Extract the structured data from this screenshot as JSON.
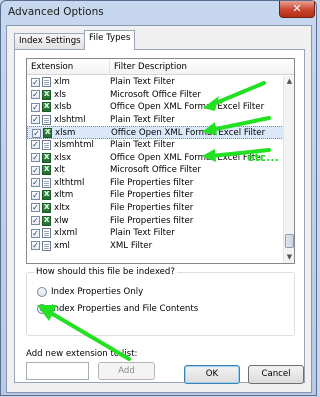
{
  "window": {
    "title": "Advanced Options",
    "close_glyph": "✕"
  },
  "tabs": [
    {
      "label": "Index Settings",
      "active": false
    },
    {
      "label": "File Types",
      "active": true
    }
  ],
  "list": {
    "headers": {
      "extension": "Extension",
      "description": "Filter Description"
    },
    "rows": [
      {
        "ext": "xlm",
        "desc": "Plain Text Filter",
        "checked": true,
        "icon": "generic-file-icon"
      },
      {
        "ext": "xls",
        "desc": "Microsoft Office Filter",
        "checked": true,
        "icon": "excel-file-icon"
      },
      {
        "ext": "xlsb",
        "desc": "Office Open XML Format Excel Filter",
        "checked": true,
        "icon": "excel-file-icon"
      },
      {
        "ext": "xlshtml",
        "desc": "Plain Text Filter",
        "checked": true,
        "icon": "generic-file-icon"
      },
      {
        "ext": "xlsm",
        "desc": "Office Open XML Format Excel Filter",
        "checked": true,
        "icon": "excel-file-icon",
        "selected": true
      },
      {
        "ext": "xlsmhtml",
        "desc": "Plain Text Filter",
        "checked": true,
        "icon": "generic-file-icon"
      },
      {
        "ext": "xlsx",
        "desc": "Office Open XML Format Excel Filter",
        "checked": true,
        "icon": "excel-file-icon"
      },
      {
        "ext": "xlt",
        "desc": "Microsoft Office Filter",
        "checked": true,
        "icon": "excel-file-icon"
      },
      {
        "ext": "xlthtml",
        "desc": "File Properties filter",
        "checked": true,
        "icon": "generic-file-icon"
      },
      {
        "ext": "xltm",
        "desc": "File Properties filter",
        "checked": true,
        "icon": "excel-file-icon"
      },
      {
        "ext": "xltx",
        "desc": "File Properties filter",
        "checked": true,
        "icon": "excel-file-icon"
      },
      {
        "ext": "xlw",
        "desc": "File Properties filter",
        "checked": true,
        "icon": "excel-file-icon"
      },
      {
        "ext": "xlxml",
        "desc": "Plain Text Filter",
        "checked": true,
        "icon": "generic-file-icon"
      },
      {
        "ext": "xml",
        "desc": "XML Filter",
        "checked": true,
        "icon": "generic-file-icon"
      }
    ]
  },
  "indexing": {
    "question": "How should this file be indexed?",
    "options": [
      {
        "label": "Index Properties Only",
        "selected": false
      },
      {
        "label": "Index Properties and File Contents",
        "selected": true
      }
    ]
  },
  "add_extension": {
    "label": "Add new extension to list:",
    "value": "",
    "button": "Add"
  },
  "buttons": {
    "ok": "OK",
    "cancel": "Cancel"
  },
  "annotation": {
    "text": "etc...",
    "color": "#22e022"
  }
}
